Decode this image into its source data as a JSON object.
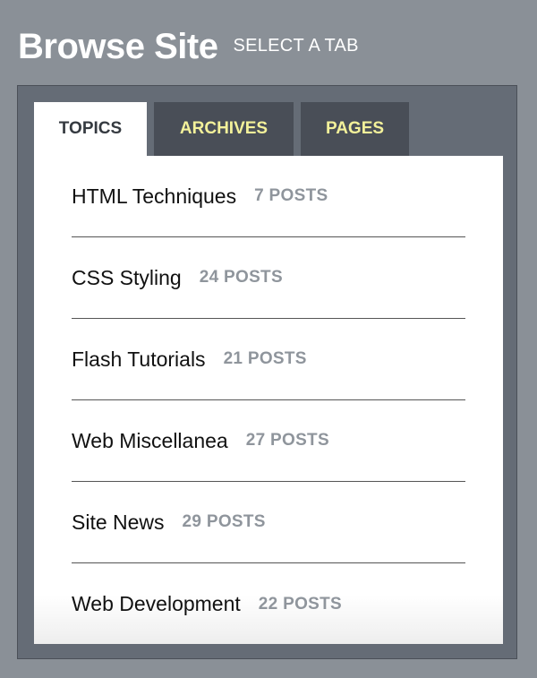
{
  "header": {
    "title": "Browse Site",
    "subtitle": "SELECT A TAB"
  },
  "tabs": [
    {
      "label": "TOPICS",
      "active": true
    },
    {
      "label": "ARCHIVES",
      "active": false
    },
    {
      "label": "PAGES",
      "active": false
    }
  ],
  "topics": [
    {
      "name": "HTML Techniques",
      "count": "7 POSTS"
    },
    {
      "name": "CSS Styling",
      "count": "24 POSTS"
    },
    {
      "name": "Flash Tutorials",
      "count": "21 POSTS"
    },
    {
      "name": "Web Miscellanea",
      "count": "27 POSTS"
    },
    {
      "name": "Site News",
      "count": "29 POSTS"
    },
    {
      "name": "Web Development",
      "count": "22 POSTS"
    }
  ],
  "colors": {
    "page_background": "#8a9097",
    "panel_background": "#656c76",
    "inactive_tab_background": "#494e57",
    "inactive_tab_text": "#f3f19a",
    "active_tab_text": "#353a40",
    "post_count_text": "#8f959c"
  }
}
